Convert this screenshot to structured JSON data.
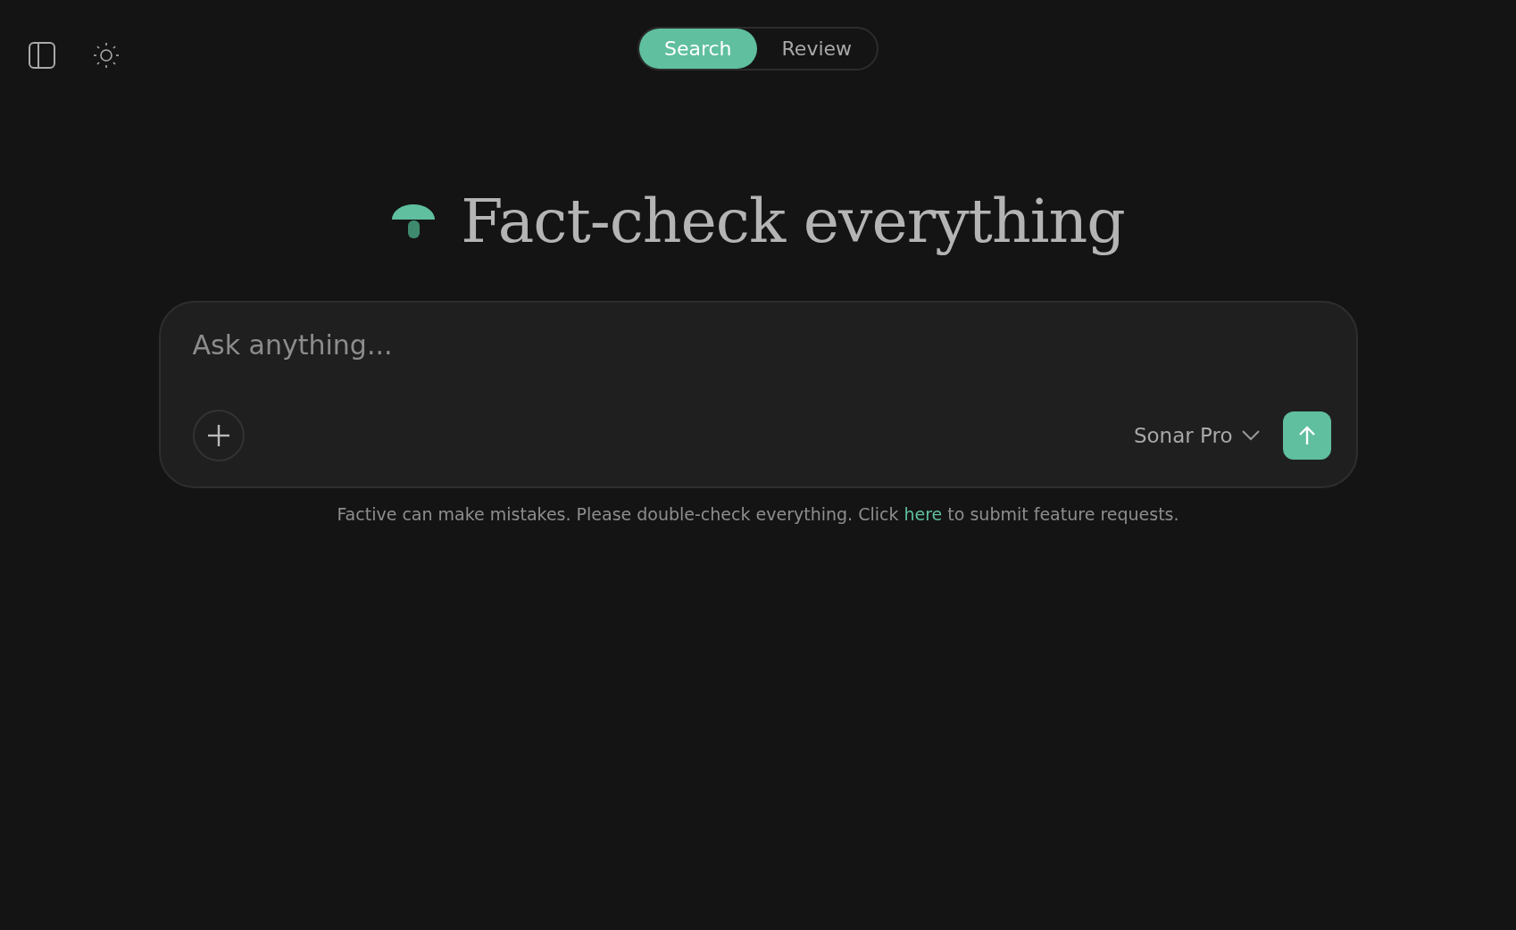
{
  "tabs": [
    {
      "label": "Search",
      "selected": true
    },
    {
      "label": "Review",
      "selected": false
    }
  ],
  "heading": "Fact-check everything",
  "composer": {
    "placeholder": "Ask anything...",
    "model": "Sonar Pro"
  },
  "footer": {
    "before": "Factive can make mistakes. Please double-check everything. Click",
    "link": "here",
    "after": "to submit feature requests."
  }
}
